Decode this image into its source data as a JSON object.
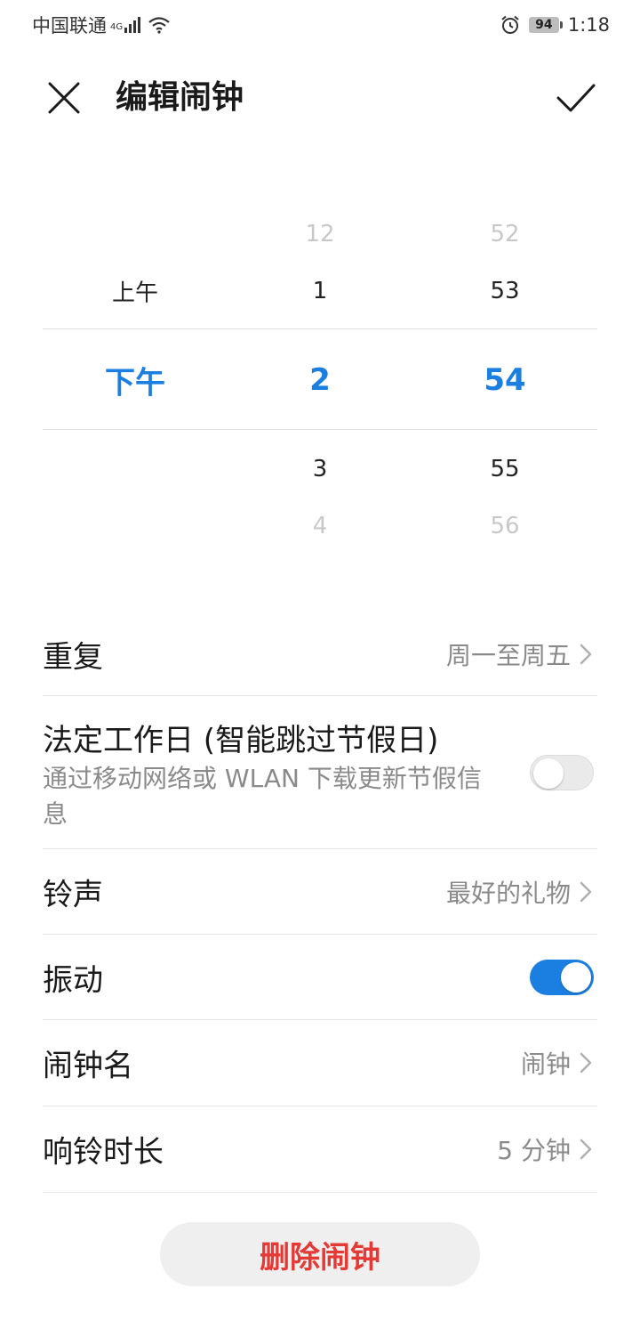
{
  "status_bar": {
    "carrier": "中国联通",
    "network": "4G",
    "battery": "94",
    "time": "1:18"
  },
  "header": {
    "title": "编辑闹钟",
    "close_icon": "close-icon",
    "confirm_icon": "check-icon"
  },
  "picker": {
    "ampm": {
      "above": "上午",
      "selected": "下午"
    },
    "hours": [
      "12",
      "1",
      "2",
      "3",
      "4"
    ],
    "minutes": [
      "52",
      "53",
      "54",
      "55",
      "56"
    ]
  },
  "settings": {
    "repeat": {
      "label": "重复",
      "value": "周一至周五"
    },
    "workday": {
      "label": "法定工作日 (智能跳过节假日)",
      "subtitle": "通过移动网络或 WLAN 下载更新节假信息",
      "enabled": false
    },
    "ringtone": {
      "label": "铃声",
      "value": "最好的礼物"
    },
    "vibrate": {
      "label": "振动",
      "enabled": true
    },
    "name": {
      "label": "闹钟名",
      "value": "闹钟"
    },
    "duration": {
      "label": "响铃时长",
      "value": "5 分钟"
    }
  },
  "delete_button": "删除闹钟",
  "colors": {
    "accent": "#1a7fe0",
    "danger": "#e53935"
  }
}
